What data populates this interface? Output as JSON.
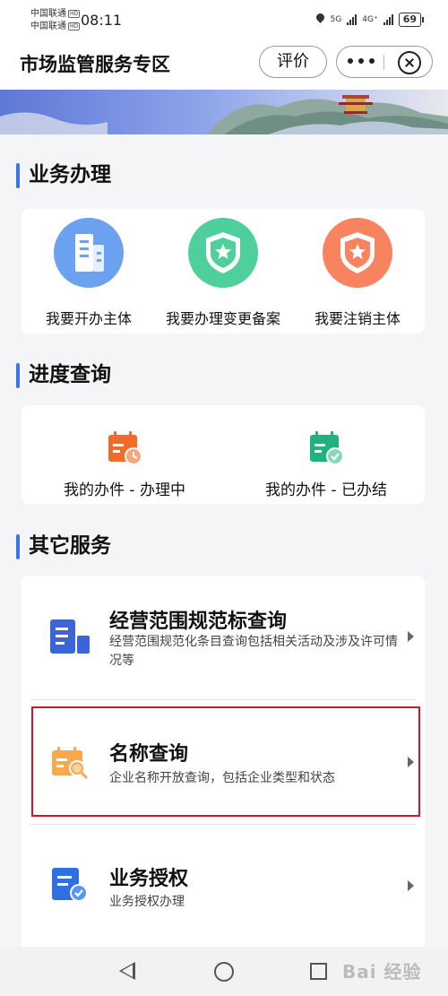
{
  "status_bar": {
    "carrier_1": "中国联通",
    "carrier_2": "中国联通",
    "hd_badge": "HD",
    "time": "08:11",
    "network_1": "5G",
    "network_2": "4G⁺",
    "battery": "69"
  },
  "header": {
    "title": "市场监管服务专区",
    "rate_label": "评价"
  },
  "sections": {
    "business": {
      "title": "业务办理",
      "items": [
        {
          "label": "我要开办主体",
          "icon": "building-icon",
          "color": "#6aa2f0"
        },
        {
          "label": "我要办理变更备案",
          "icon": "shield-star-icon",
          "color": "#4fcf9b"
        },
        {
          "label": "我要注销主体",
          "icon": "shield-star-icon",
          "color": "#f7845e"
        }
      ]
    },
    "progress": {
      "title": "进度查询",
      "items": [
        {
          "label": "我的办件 - 办理中",
          "icon": "calendar-clock-icon",
          "color": "#f16b2b"
        },
        {
          "label": "我的办件 - 已办结",
          "icon": "calendar-check-icon",
          "color": "#1fb27d"
        }
      ]
    },
    "other": {
      "title": "其它服务",
      "items": [
        {
          "title": "经营范围规范标查询",
          "desc": "经营范围规范化条目查询包括相关活动及涉及许可情况等",
          "icon": "document-bars-icon",
          "color": "#3b64d8"
        },
        {
          "title": "名称查询",
          "desc": "企业名称开放查询，包括企业类型和状态",
          "icon": "search-doc-icon",
          "color": "#f7a94d"
        },
        {
          "title": "业务授权",
          "desc": "业务授权办理",
          "icon": "authorize-doc-icon",
          "color": "#2f6fe0"
        }
      ]
    }
  },
  "watermark": "Bai 经验"
}
